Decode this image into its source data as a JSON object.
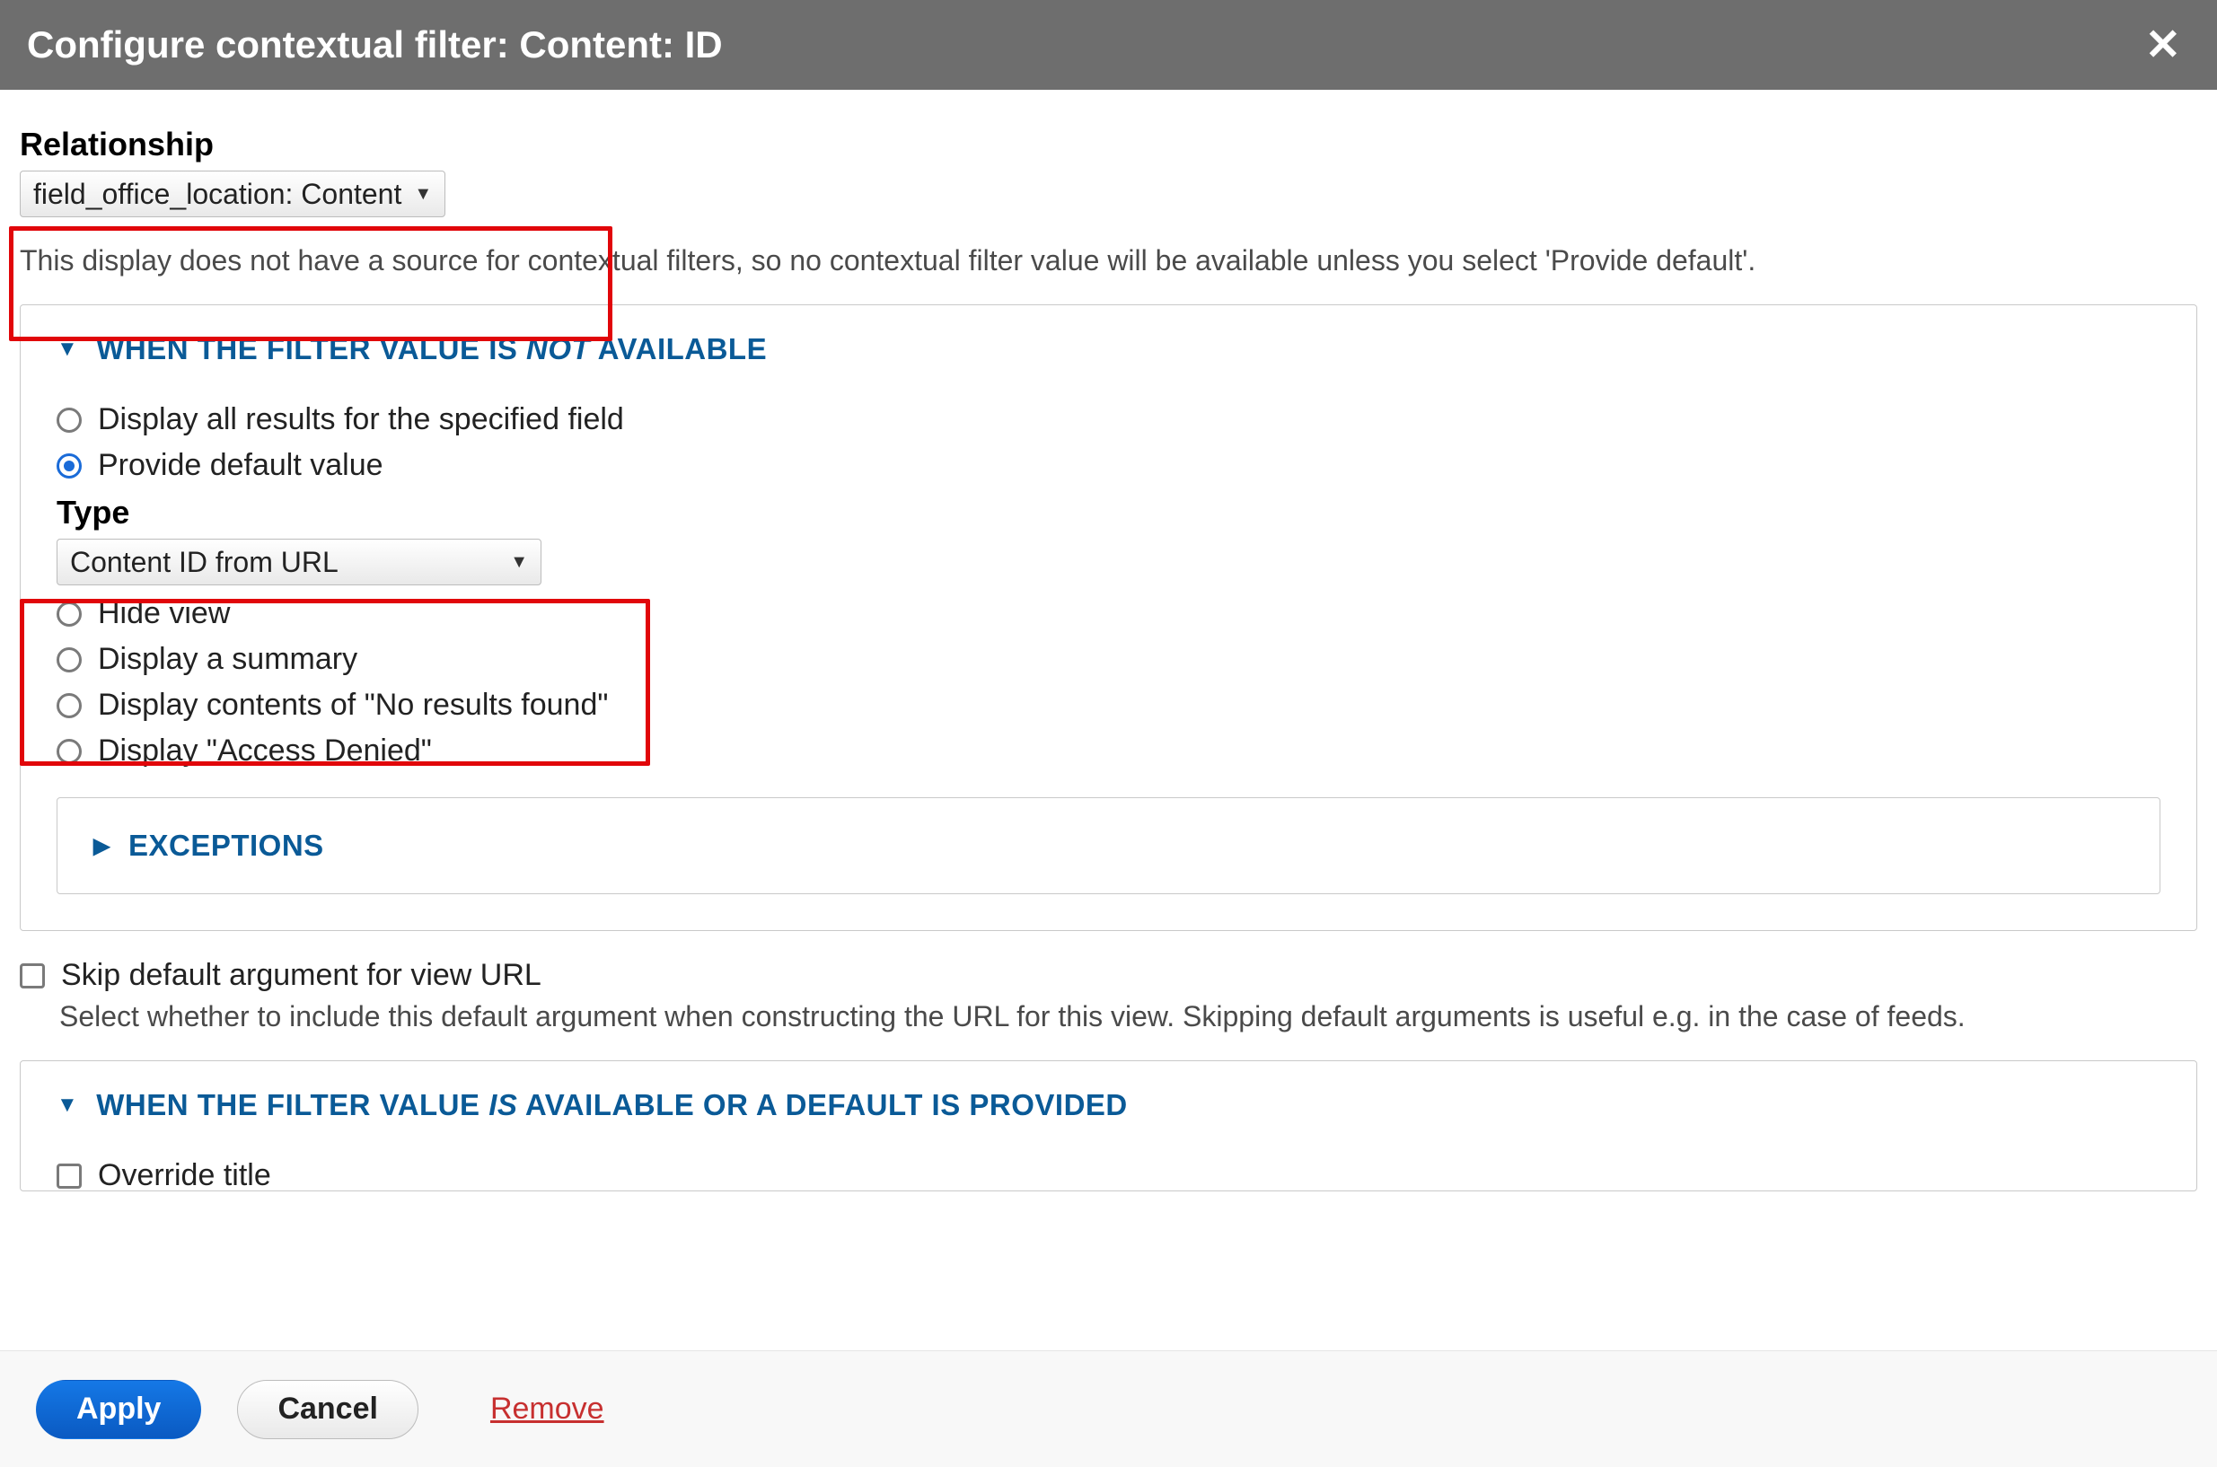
{
  "title": "Configure contextual filter: Content: ID",
  "relationship": {
    "label": "Relationship",
    "selected": "field_office_location: Content"
  },
  "contextual_note": "This display does not have a source for contextual filters, so no contextual filter value will be available unless you select 'Provide default'.",
  "not_available": {
    "heading_pre": "WHEN THE FILTER VALUE IS ",
    "heading_em": "NOT",
    "heading_post": " AVAILABLE",
    "options": [
      {
        "label": "Display all results for the specified field",
        "selected": false
      },
      {
        "label": "Provide default value",
        "selected": true
      },
      {
        "label": "Hide view",
        "selected": false
      },
      {
        "label": "Display a summary",
        "selected": false
      },
      {
        "label": "Display contents of \"No results found\"",
        "selected": false
      },
      {
        "label": "Display \"Access Denied\"",
        "selected": false
      }
    ],
    "type": {
      "label": "Type",
      "selected": "Content ID from URL"
    },
    "exceptions_heading": "EXCEPTIONS"
  },
  "skip_default": {
    "label": "Skip default argument for view URL",
    "checked": false,
    "description": "Select whether to include this default argument when constructing the URL for this view. Skipping default arguments is useful e.g. in the case of feeds."
  },
  "available": {
    "heading_pre": "WHEN THE FILTER VALUE ",
    "heading_em": "IS",
    "heading_post": " AVAILABLE OR A DEFAULT IS PROVIDED",
    "override_title_label": "Override title"
  },
  "footer": {
    "apply": "Apply",
    "cancel": "Cancel",
    "remove": "Remove"
  }
}
